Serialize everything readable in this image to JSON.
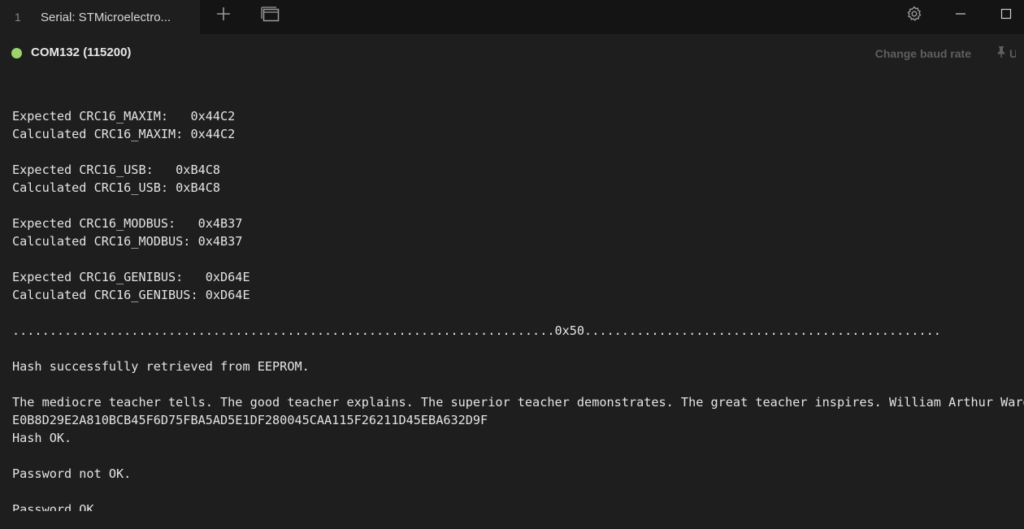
{
  "tab": {
    "index": "1",
    "title": "Serial: STMicroelectro..."
  },
  "toolbar": {
    "icons": [
      "add-icon",
      "new-window-icon",
      "gear-icon",
      "minimize-icon",
      "maximize-icon"
    ]
  },
  "status": {
    "connected_color": "#9bd46b",
    "port_label": "COM132 (115200)",
    "change_baud_label": "Change baud rate",
    "pin_label": "U"
  },
  "console": {
    "lines": [
      "",
      "Expected CRC16_MAXIM:   0x44C2",
      "Calculated CRC16_MAXIM: 0x44C2",
      "",
      "Expected CRC16_USB:   0xB4C8",
      "Calculated CRC16_USB: 0xB4C8",
      "",
      "Expected CRC16_MODBUS:   0x4B37",
      "Calculated CRC16_MODBUS: 0x4B37",
      "",
      "Expected CRC16_GENIBUS:   0xD64E",
      "Calculated CRC16_GENIBUS: 0xD64E",
      "",
      ".........................................................................0x50................................................",
      "",
      "Hash successfully retrieved from EEPROM.",
      "",
      "The mediocre teacher tells. The good teacher explains. The superior teacher demonstrates. The great teacher inspires. William Arthur Ward",
      "E0B8D29E2A810BCB45F6D75FBA5AD5E1DF280045CAA115F26211D45EBA632D9F",
      "Hash OK.",
      "",
      "Password not OK.",
      "",
      "Password OK."
    ]
  }
}
